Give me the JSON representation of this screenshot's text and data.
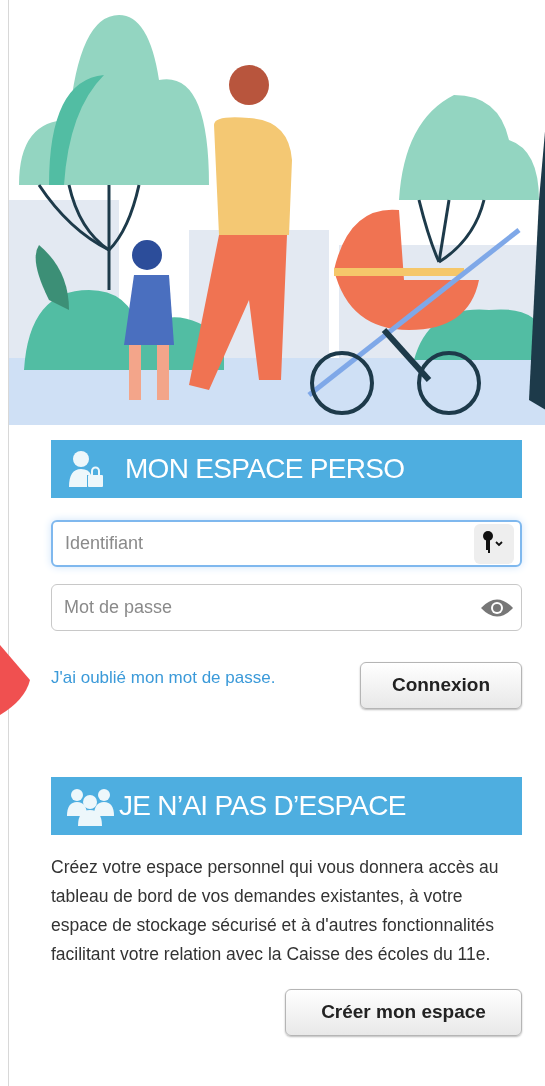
{
  "login": {
    "title": "MON ESPACE PERSO",
    "fields": [
      {
        "kind": "text",
        "placeholder": "Identifiant",
        "focused": true
      },
      {
        "kind": "password",
        "placeholder": "Mot de passe",
        "focused": false
      }
    ],
    "forgot_link": "J'ai oublié mon mot de passe.",
    "submit": "Connexion"
  },
  "signup": {
    "title": "JE N’AI PAS D’ESPACE",
    "text": "Créez votre espace personnel qui vous donnera accès au tableau de bord de vos demandes existantes, à votre espace de stockage sécurisé et à d'autres fonctionnalités facilitant votre relation avec la Caisse des écoles du 11e.",
    "button": "Créer mon espace"
  }
}
